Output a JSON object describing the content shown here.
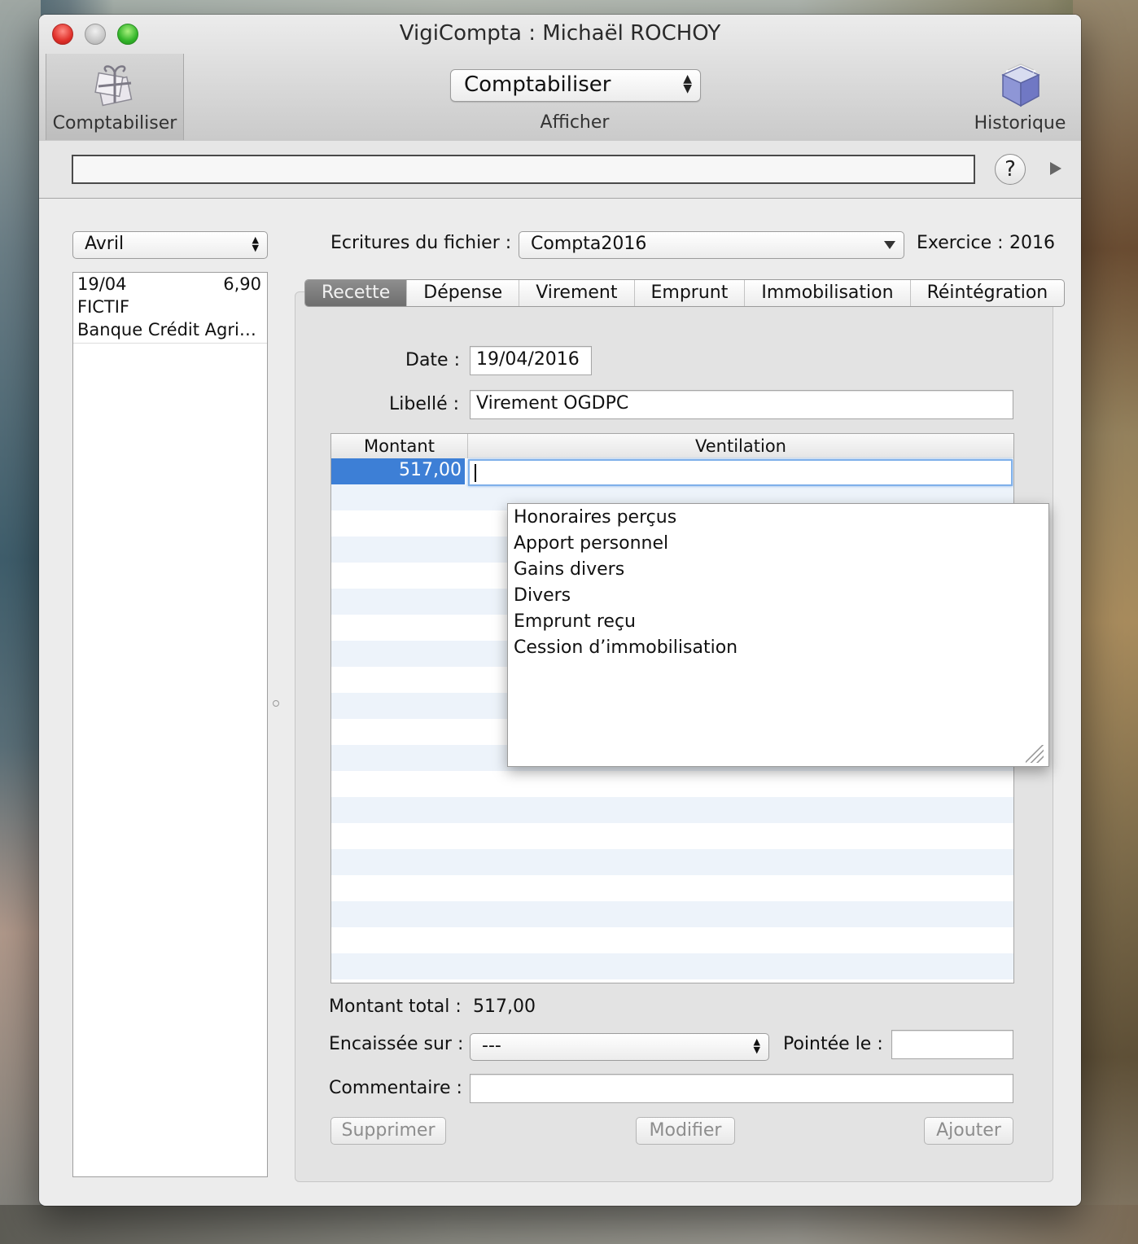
{
  "window": {
    "title": "VigiCompta : Michaël ROCHOY"
  },
  "toolbar": {
    "left_button_label": "Comptabiliser",
    "view_select_value": "Comptabiliser",
    "view_select_caption": "Afficher",
    "right_button_label": "Historique"
  },
  "search": {
    "value": "",
    "help_glyph": "?"
  },
  "sidebar": {
    "month_select_value": "Avril",
    "entries": [
      {
        "date": "19/04",
        "amount": "6,90",
        "name": "FICTIF",
        "bank": "Banque Crédit Agri…"
      }
    ]
  },
  "header": {
    "file_label": "Ecritures du fichier :",
    "file_value": "Compta2016",
    "exercice_label": "Exercice :",
    "exercice_value": "2016"
  },
  "tabs": [
    {
      "label": "Recette",
      "active": true
    },
    {
      "label": "Dépense",
      "active": false
    },
    {
      "label": "Virement",
      "active": false
    },
    {
      "label": "Emprunt",
      "active": false
    },
    {
      "label": "Immobilisation",
      "active": false
    },
    {
      "label": "Réintégration",
      "active": false
    }
  ],
  "form": {
    "date_label": "Date :",
    "date_value": "19/04/2016",
    "libelle_label": "Libellé :",
    "libelle_value": "Virement OGDPC",
    "table": {
      "col_montant": "Montant",
      "col_ventilation": "Ventilation",
      "selected_amount": "517,00",
      "ventilation_input_value": ""
    },
    "ventilation_options": [
      "Honoraires perçus",
      "Apport personnel",
      "Gains divers",
      "Divers",
      "Emprunt reçu",
      "Cession d’immobilisation"
    ],
    "total_label": "Montant total :",
    "total_value": "517,00",
    "encaissee_label": "Encaissée sur :",
    "encaissee_value": "---",
    "pointee_label": "Pointée le :",
    "pointee_value": "",
    "commentaire_label": "Commentaire :",
    "commentaire_value": ""
  },
  "buttons": {
    "supprimer": "Supprimer",
    "modifier": "Modifier",
    "ajouter": "Ajouter"
  },
  "colors": {
    "selection": "#3d7fd6",
    "active_tab": "#7a7a7a",
    "focus_ring": "#7fb0ea"
  }
}
